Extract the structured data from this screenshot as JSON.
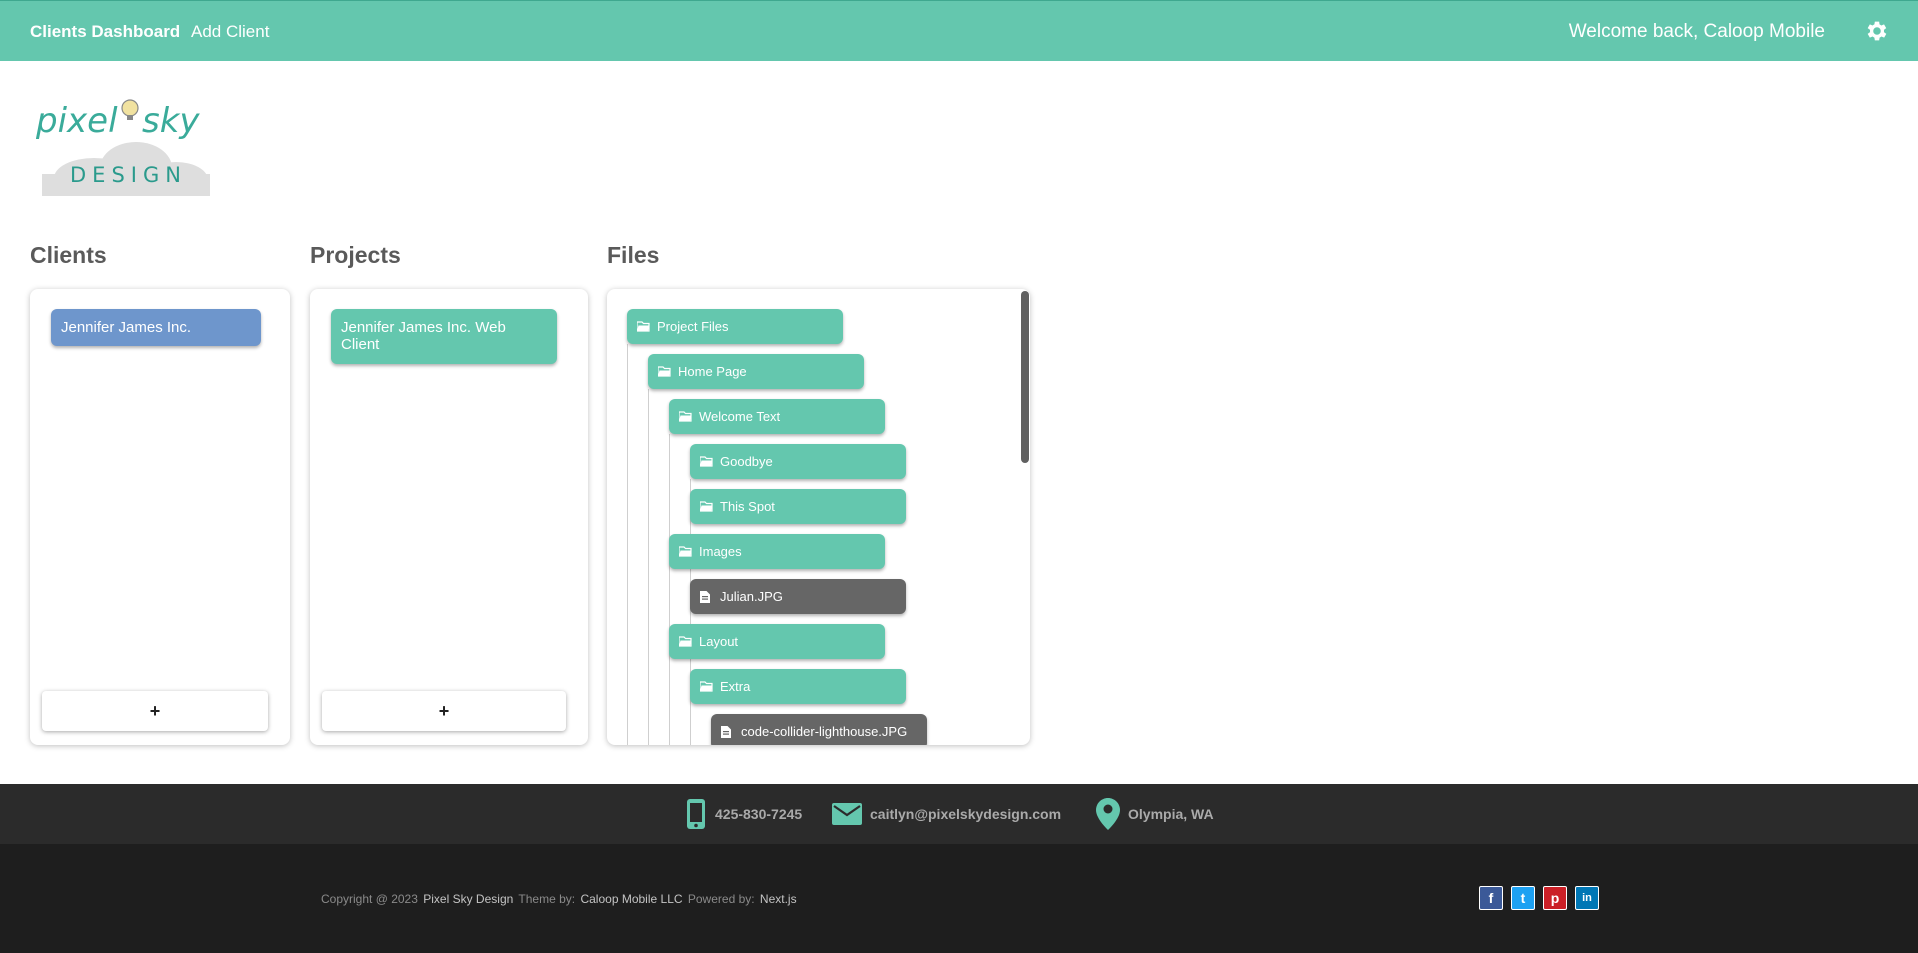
{
  "header": {
    "nav_dashboard": "Clients Dashboard",
    "nav_add_client": "Add Client",
    "welcome": "Welcome back, Caloop Mobile",
    "settings_icon": "gear-icon"
  },
  "logo": {
    "word1": "pixel",
    "word2": "sky",
    "word3": "DESIGN"
  },
  "columns": {
    "clients_title": "Clients",
    "projects_title": "Projects",
    "files_title": "Files"
  },
  "clients": [
    {
      "name": "Jennifer James Inc."
    }
  ],
  "projects": [
    {
      "name": "Jennifer James Inc. Web Client"
    }
  ],
  "add_label": "+",
  "files": [
    {
      "name": "Project Files",
      "type": "folder",
      "depth": 0
    },
    {
      "name": "Home Page",
      "type": "folder",
      "depth": 1
    },
    {
      "name": "Welcome Text",
      "type": "folder",
      "depth": 2
    },
    {
      "name": "Goodbye",
      "type": "folder",
      "depth": 3
    },
    {
      "name": "This Spot",
      "type": "folder",
      "depth": 3
    },
    {
      "name": "Images",
      "type": "folder",
      "depth": 2
    },
    {
      "name": "Julian.JPG",
      "type": "file",
      "depth": 3
    },
    {
      "name": "Layout",
      "type": "folder",
      "depth": 2
    },
    {
      "name": "Extra",
      "type": "folder",
      "depth": 3
    },
    {
      "name": "code-collider-lighthouse.JPG",
      "type": "file",
      "depth": 4
    }
  ],
  "contact": {
    "phone": "425-830-7245",
    "email": "caitlyn@pixelskydesign.com",
    "location": "Olympia, WA"
  },
  "footer": {
    "copyright_prefix": "Copyright @ 2023",
    "company": "Pixel Sky Design",
    "theme_by": "Theme by:",
    "theme_author": "Caloop Mobile LLC",
    "powered_by": "Powered by:",
    "powered": "Next.js"
  },
  "social": [
    {
      "name": "facebook",
      "letter": "f",
      "color": "#3b5998"
    },
    {
      "name": "twitter",
      "letter": "t",
      "color": "#1da1f2"
    },
    {
      "name": "pinterest",
      "letter": "p",
      "color": "#cb2027"
    },
    {
      "name": "linkedin",
      "letter": "in",
      "color": "#0077b5"
    }
  ],
  "colors": {
    "accent": "#64c7ae",
    "client_pill": "#6e96cc",
    "file_pill": "#666666",
    "footer_dark": "#1e1e1e"
  }
}
